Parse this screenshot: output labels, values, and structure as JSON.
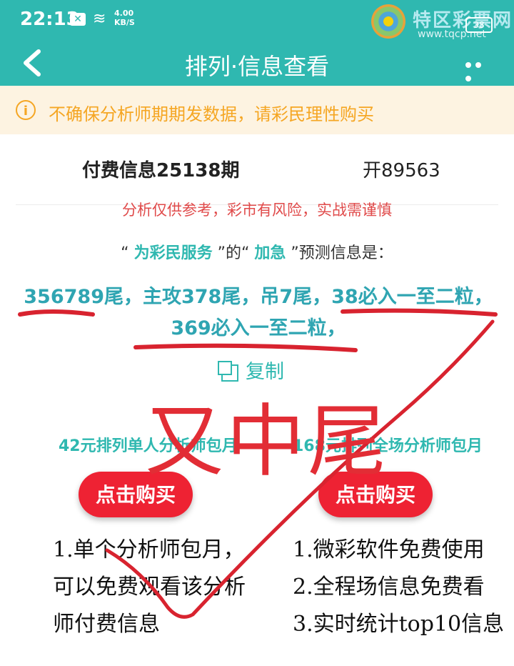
{
  "status_bar": {
    "time": "22:13",
    "network_speed": "4.00\nKB/S",
    "battery": "38",
    "watermark_text": "特区彩票网",
    "watermark_url": "www.tqcp.net"
  },
  "header": {
    "title": "排列·信息查看",
    "back_icon": "chevron-left-icon",
    "more_icon": "more-dots-icon"
  },
  "notice": {
    "icon": "info-circle-icon",
    "text": "不确保分析师期期发数据，请彩民理性购买"
  },
  "info": {
    "period": "付费信息25138期",
    "draw_result": "开89563",
    "risk_warning": "分析仅供参考，彩市有风险，实战需谨慎",
    "predict_prefix": "“",
    "analyst_name": "为彩民服务",
    "predict_middle": "”的“",
    "tag": "加急",
    "predict_suffix": "”预测信息是：",
    "prediction": "356789尾，主攻378尾，吊7尾，38必入一至二粒，369必入一至二粒，",
    "copy_label": "复制"
  },
  "plans": {
    "left": {
      "title": "42元排列单人分析师包月",
      "button": "点击购买",
      "features": [
        "1.单个分析师包月，",
        "可以免费观看该分析",
        "师付费信息"
      ]
    },
    "right": {
      "title": "168元排列全场分析师包月",
      "button": "点击购买",
      "features": [
        "1.微彩软件免费使用",
        "2.全程场信息免费看",
        "3.实时统计top10信息"
      ]
    }
  },
  "annotation": {
    "handwritten_text": "又中尾"
  },
  "colors": {
    "teal": "#2fb8b0",
    "notice_bg": "#fdf3e1",
    "notice_text": "#f5a623",
    "red": "#ee2233"
  }
}
